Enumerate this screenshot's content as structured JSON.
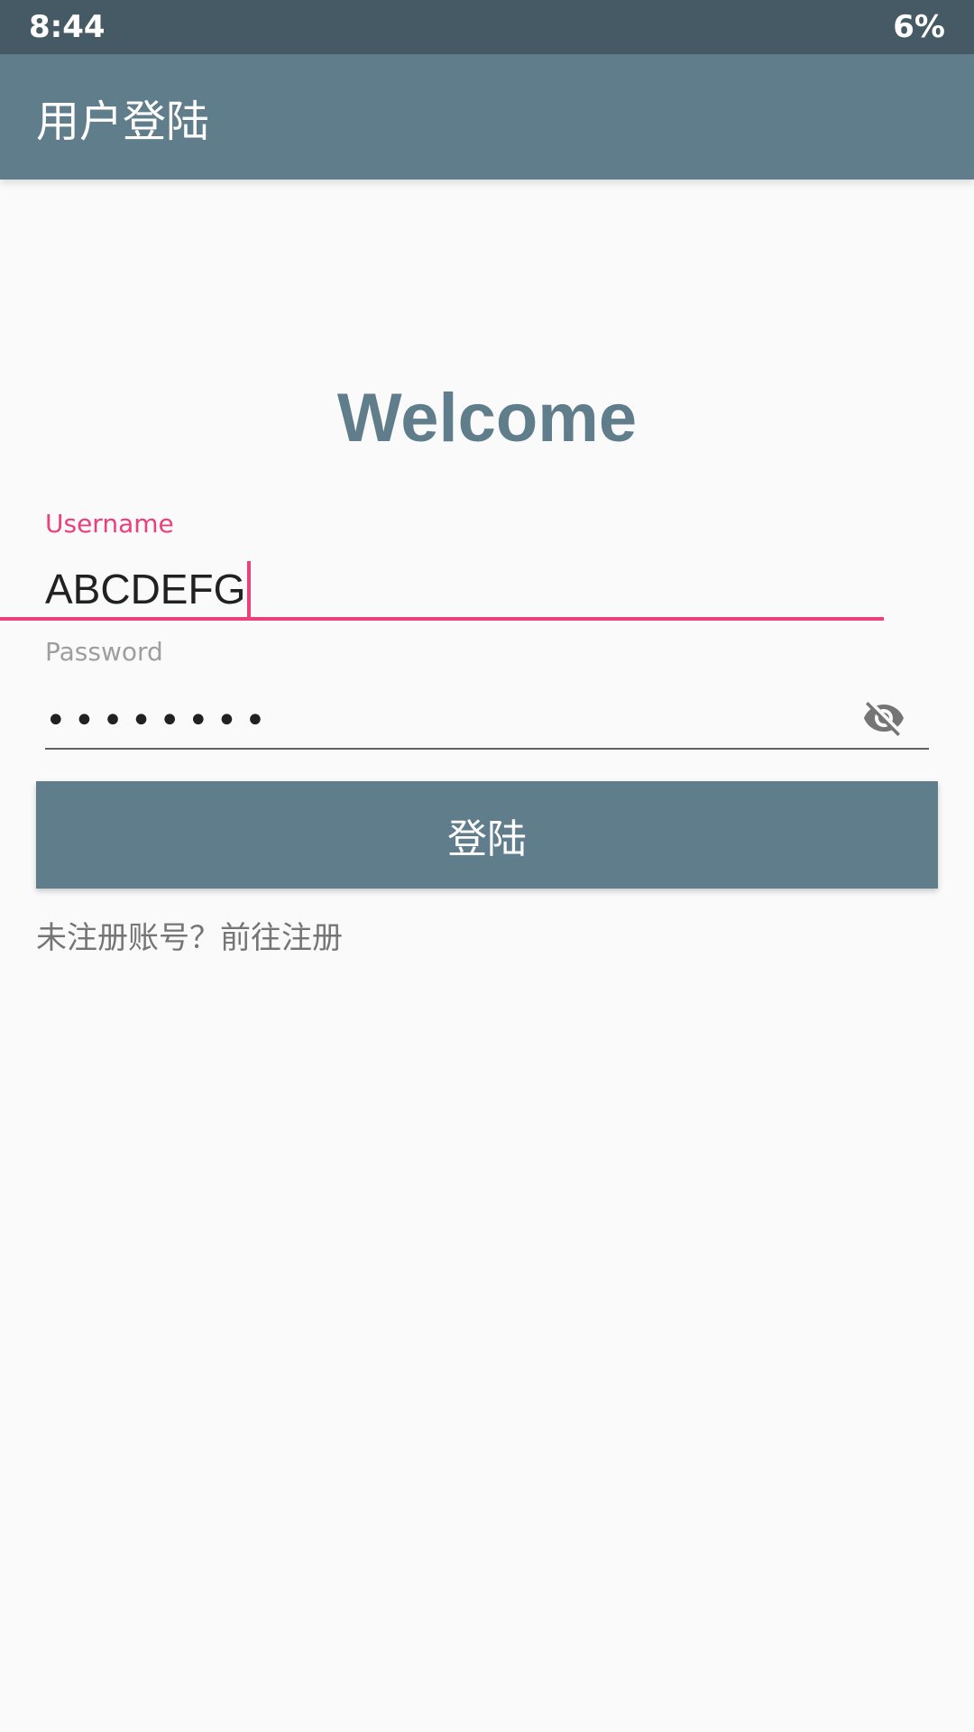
{
  "status_bar": {
    "time": "8:44",
    "battery": "6%"
  },
  "app_bar": {
    "title": "用户登陆"
  },
  "welcome": {
    "heading": "Welcome"
  },
  "form": {
    "username": {
      "label": "Username",
      "value": "ABCDEFG"
    },
    "password": {
      "label": "Password",
      "masked_value": "••••••••",
      "toggle_icon": "visibility-off-icon"
    },
    "login_label": "登陆",
    "register_text": "未注册账号？前往注册"
  },
  "colors": {
    "primary": "#607d8b",
    "primary_dark": "#455a64",
    "accent": "#ec407a"
  }
}
